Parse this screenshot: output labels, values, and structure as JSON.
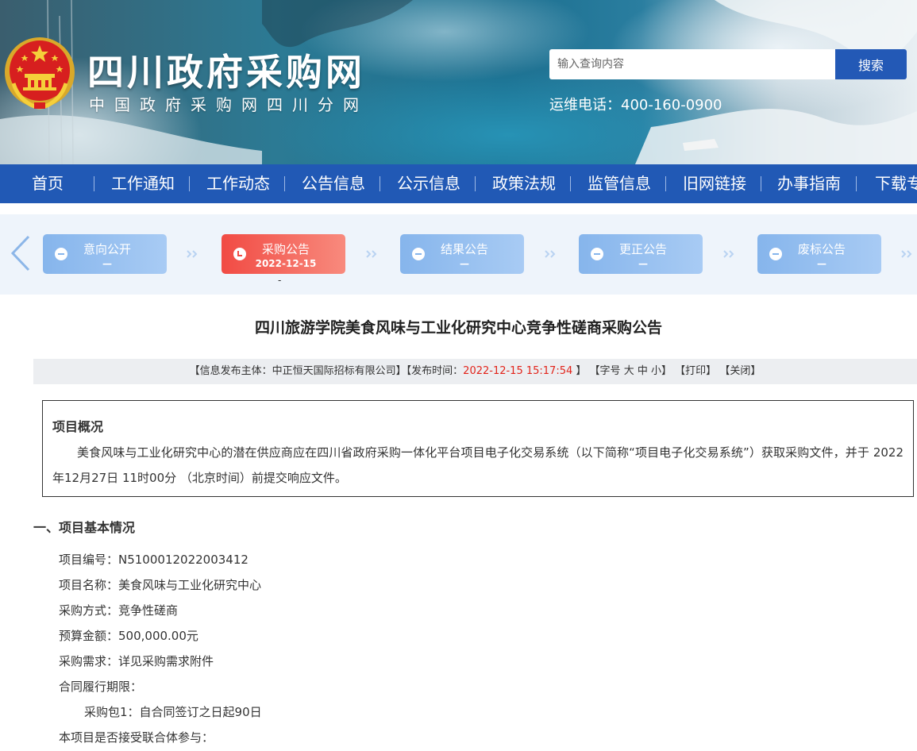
{
  "header": {
    "site_title": "四川政府采购网",
    "site_subtitle": "中国政府采购网四川分网",
    "search_placeholder": "输入查询内容",
    "search_button": "搜索",
    "hotline": "运维电话：400-160-0900"
  },
  "nav": {
    "items": [
      "首页",
      "工作通知",
      "工作动态",
      "公告信息",
      "公示信息",
      "政策法规",
      "监管信息",
      "旧网链接",
      "办事指南",
      "下载专"
    ]
  },
  "steps": {
    "items": [
      {
        "label": "意向公开",
        "date": "—",
        "active": false
      },
      {
        "label": "采购公告",
        "date": "2022-12-15",
        "active": true
      },
      {
        "label": "结果公告",
        "date": "—",
        "active": false
      },
      {
        "label": "更正公告",
        "date": "—",
        "active": false
      },
      {
        "label": "废标公告",
        "date": "—",
        "active": false
      }
    ],
    "active_sub": "-"
  },
  "article": {
    "title": "四川旅游学院美食风味与工业化研究中心竞争性磋商采购公告",
    "meta": {
      "publisher_prefix": "【信息发布主体：中正恒天国际招标有限公司】【发布时间：",
      "time": "2022-12-15 15:17:54",
      "time_suffix": " 】",
      "font_size_prefix": "【字号",
      "size_large": "大",
      "size_medium": "中",
      "size_small": "小",
      "font_size_suffix": "】",
      "print": "【打印】",
      "close": "【关闭】"
    },
    "overview": {
      "title": "项目概况",
      "text": "美食风味与工业化研究中心的潜在供应商应在四川省政府采购一体化平台项目电子化交易系统（以下简称“项目电子化交易系统”）获取采购文件，并于 2022年12月27日 11时00分 （北京时间）前提交响应文件。"
    },
    "section1_title": "一、项目基本情况",
    "lines": [
      "项目编号：N5100012022003412",
      "项目名称：美食风味与工业化研究中心",
      "采购方式：竞争性磋商",
      "预算金额：500,000.00元",
      "采购需求：详见采购需求附件",
      "合同履行期限：",
      "采购包1：自合同签订之日起90日",
      "本项目是否接受联合体参与："
    ]
  }
}
